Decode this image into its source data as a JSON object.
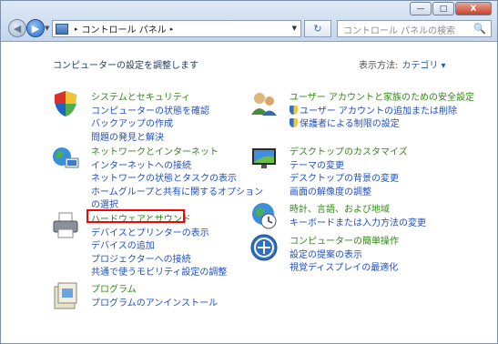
{
  "window": {
    "controls": {
      "minimize": "—",
      "maximize": "□",
      "close": "X"
    }
  },
  "toolbar": {
    "back": "◀",
    "forward": "▶",
    "history": "▼",
    "address": {
      "crumb_sep1": "▸",
      "location": "コントロール パネル",
      "crumb_sep2": "▸",
      "dropdown": "▼"
    },
    "refresh": "↻",
    "search_placeholder": "コントロール パネルの検索",
    "search_icon": "🔍"
  },
  "header": {
    "heading": "コンピューターの設定を調整します",
    "view_by_label": "表示方法:",
    "view_by_value": "カテゴリ ▾"
  },
  "categories": [
    {
      "title": "システムとセキュリティ",
      "icon": "shield-icon",
      "links": [
        "コンピューターの状態を確認",
        "バックアップの作成",
        "問題の発見と解決"
      ]
    },
    {
      "title": "ネットワークとインターネット",
      "icon": "network-icon",
      "links": [
        "インターネットへの接続",
        "ネットワークの状態とタスクの表示",
        "ホームグループと共有に関するオプション",
        "の選択"
      ]
    },
    {
      "title": "ハードウェアとサウンド",
      "icon": "printer-icon",
      "links": [
        "デバイスとプリンターの表示",
        "デバイスの追加",
        "プロジェクターへの接続",
        "共通で使うモビリティ設定の調整"
      ]
    },
    {
      "title": "プログラム",
      "icon": "programs-icon",
      "links": [
        "プログラムのアンインストール"
      ]
    },
    {
      "title": "ユーザー アカウントと家族のための安全設定",
      "icon": "users-icon",
      "links": [
        "ユーザー アカウントの追加または削除",
        "保護者による制限の設定"
      ]
    },
    {
      "title": "デスクトップのカスタマイズ",
      "icon": "monitor-icon",
      "links": [
        "テーマの変更",
        "デスクトップの背景の変更",
        "画面の解像度の調整"
      ]
    },
    {
      "title": "時計、言語、および地域",
      "icon": "globe-clock-icon",
      "links": [
        "キーボードまたは入力方法の変更"
      ]
    },
    {
      "title": "コンピューターの簡単操作",
      "icon": "ease-of-access-icon",
      "links": [
        "設定の提案の表示",
        "視覚ディスプレイの最適化"
      ]
    }
  ]
}
